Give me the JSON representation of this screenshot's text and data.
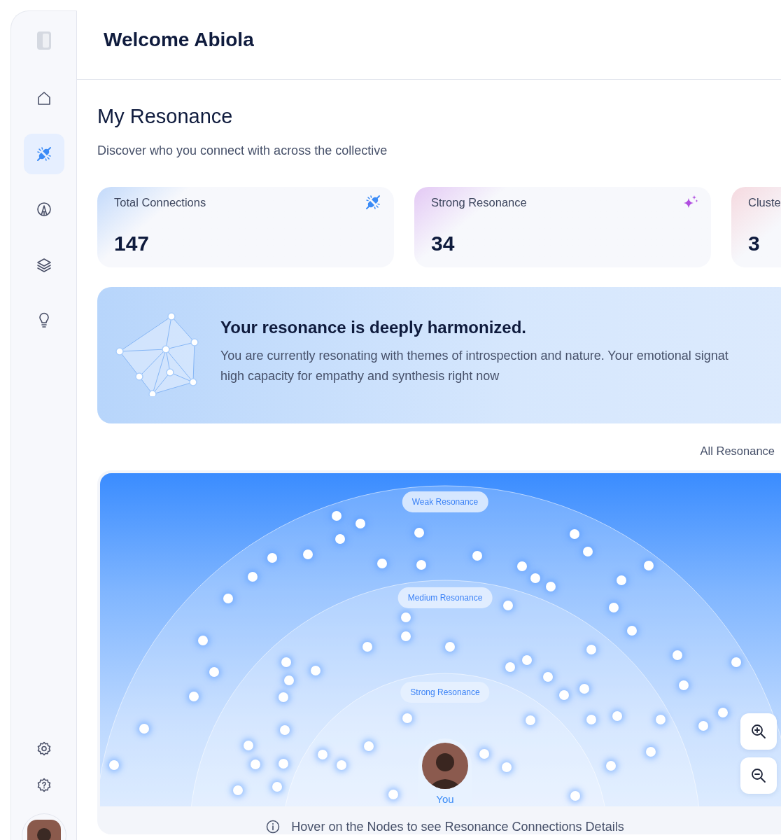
{
  "sidebar": {
    "nav": [
      {
        "kind": "home",
        "selected": false
      },
      {
        "kind": "connections",
        "selected": true
      },
      {
        "kind": "creative",
        "selected": false
      },
      {
        "kind": "layers",
        "selected": false
      },
      {
        "kind": "ideas",
        "selected": false
      }
    ]
  },
  "header": {
    "title": "Welcome Abiola"
  },
  "page": {
    "title": "My Resonance",
    "subtitle": "Discover who you connect with across the collective"
  },
  "stats": [
    {
      "label": "Total Connections",
      "value": "147",
      "kind": "connections"
    },
    {
      "label": "Strong Resonance",
      "value": "34",
      "kind": "sparkle"
    },
    {
      "label": "Cluste",
      "value": "3",
      "kind": "clusters"
    }
  ],
  "insight": {
    "title": "Your resonance is deeply harmonized.",
    "text": "You are currently resonating with themes of introspection and nature. Your emotional signat\nhigh capacity for empathy and synthesis right now"
  },
  "filter": {
    "label": "All Resonance"
  },
  "map": {
    "rings": [
      "Weak Resonance",
      "Medium Resonance",
      "Strong Resonance"
    ],
    "center_label": "You",
    "hint": "Hover on the Nodes to see Resonance Connections Details"
  }
}
